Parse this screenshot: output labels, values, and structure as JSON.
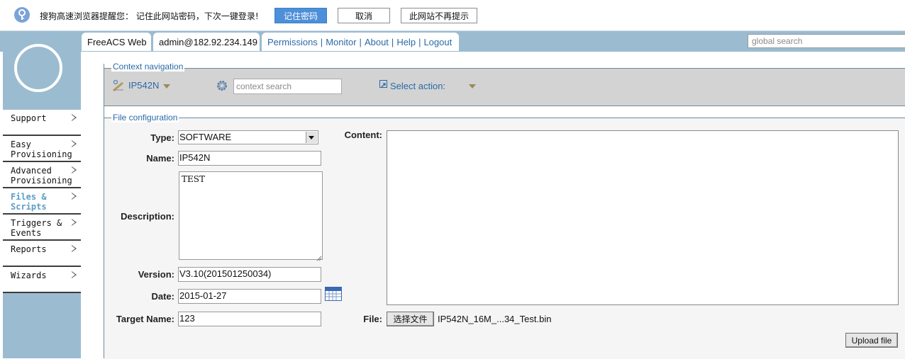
{
  "password_bar": {
    "message": "搜狗高速浏览器提醒您： 记住此网站密码，下次一键登录!",
    "remember_label": "记住密码",
    "cancel_label": "取消",
    "never_label": "此网站不再提示"
  },
  "header": {
    "app_title": "FreeACS Web",
    "user": "admin@182.92.234.149",
    "links": [
      "Permissions",
      "Monitor",
      "About",
      "Help",
      "Logout"
    ],
    "global_search_placeholder": "global search"
  },
  "sidebar": {
    "items": [
      {
        "label": "Support"
      },
      {
        "label": "Easy\nProvisioning"
      },
      {
        "label": "Advanced\nProvisioning"
      },
      {
        "label": "Files &\nScripts",
        "active": true
      },
      {
        "label": "Triggers &\nEvents"
      },
      {
        "label": "Reports"
      },
      {
        "label": "Wizards"
      }
    ]
  },
  "context_nav": {
    "legend": "Context navigation",
    "unit": "IP542N",
    "search_placeholder": "context search",
    "action_label": "Select action:"
  },
  "file_config": {
    "legend": "File configuration",
    "type_label": "Type:",
    "type_value": "SOFTWARE",
    "name_label": "Name:",
    "name_value": "IP542N",
    "description_label": "Description:",
    "description_value": "TEST",
    "version_label": "Version:",
    "version_value": "V3.10(201501250034)",
    "date_label": "Date:",
    "date_value": "2015-01-27",
    "target_label": "Target Name:",
    "target_value": "123",
    "content_label": "Content:",
    "content_value": "",
    "file_label": "File:",
    "file_button_label": "选择文件",
    "file_name": "IP542N_16M_...34_Test.bin",
    "upload_label": "Upload file"
  }
}
